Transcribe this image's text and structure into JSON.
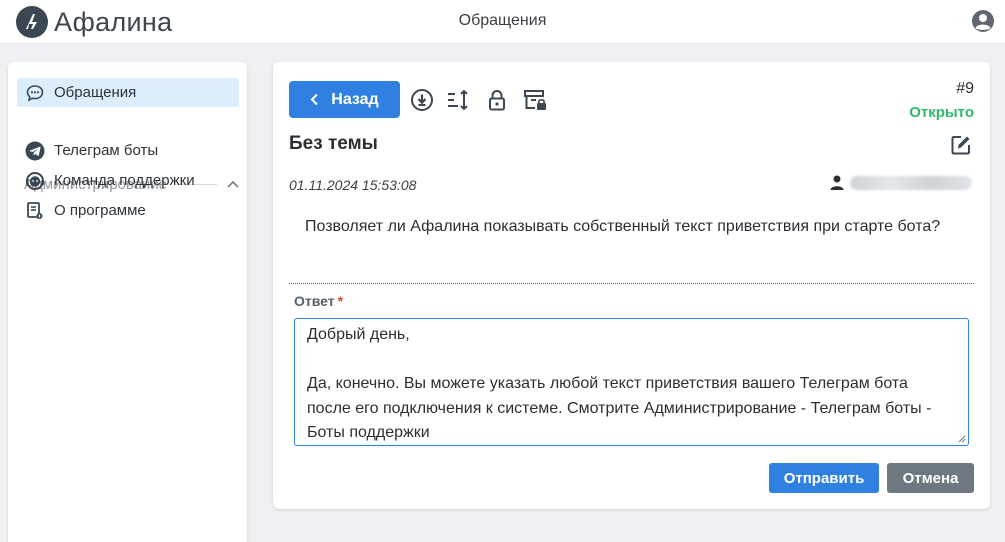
{
  "app": {
    "title": "Афалина"
  },
  "header": {
    "page_title": "Обращения"
  },
  "sidebar": {
    "active_item": "Обращения",
    "section_title": "Администрирование",
    "items": [
      {
        "label": "Телеграм боты",
        "icon": "telegram-icon"
      },
      {
        "label": "Команда поддержки",
        "icon": "support-team-icon"
      },
      {
        "label": "О программе",
        "icon": "about-program-icon"
      }
    ]
  },
  "ticket": {
    "back_label": "Назад",
    "number": "#9",
    "status": "Открыто",
    "subject": "Без темы",
    "date": "01.11.2024 15:53:08",
    "question": "Позволяет ли Афалина показывать собственный текст приветствия при старте бота?",
    "answer_label": "Ответ",
    "required_mark": "*",
    "answer_text": "Добрый день,\n\nДа, конечно. Вы можете указать любой текст приветствия вашего Телеграм бота после его подключения к системе. Смотрите Администрирование - Телеграм боты - Боты поддержки",
    "send_label": "Отправить",
    "cancel_label": "Отмена"
  },
  "colors": {
    "accent": "#2f80e0",
    "status_open": "#2fb86a",
    "cancel": "#6d7882",
    "active_nav_bg": "#dceefb"
  }
}
